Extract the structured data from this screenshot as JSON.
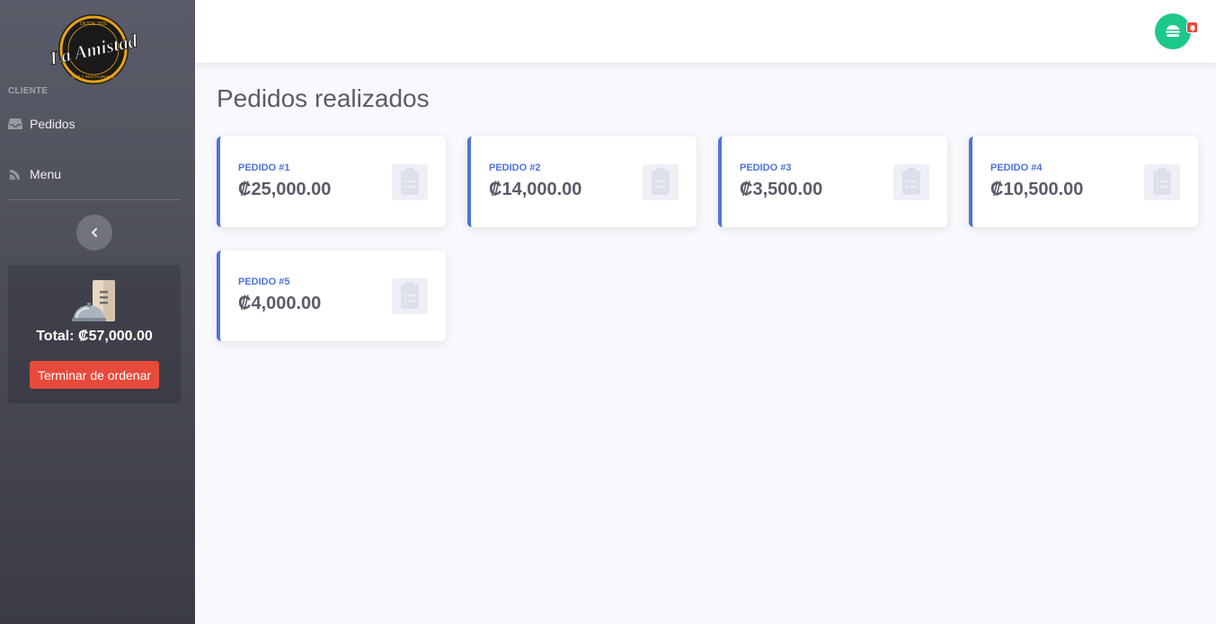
{
  "brand": {
    "name": "La Amistad",
    "tagline_top": "DESDE 2020",
    "tagline_bottom": "BAR Y RESTAURANTE",
    "logo_icon": "la-amistad-logo"
  },
  "sidebar": {
    "section_label": "CLIENTE",
    "items": [
      {
        "label": "Pedidos",
        "icon": "inbox-icon"
      },
      {
        "label": "Menu",
        "icon": "utensils-icon"
      }
    ],
    "toggle_icon": "chevron-left-icon"
  },
  "cart": {
    "icon": "service-bell-receipt-icon",
    "total_label": "Total: ₡57,000.00",
    "button_label": "Terminar de ordenar"
  },
  "topbar": {
    "avatar_icon": "burger-icon",
    "badge_icon": "bell-icon"
  },
  "main": {
    "title": "Pedidos realizados",
    "orders": [
      {
        "label": "PEDIDO #1",
        "amount": "₡25,000.00"
      },
      {
        "label": "PEDIDO #2",
        "amount": "₡14,000.00"
      },
      {
        "label": "PEDIDO #3",
        "amount": "₡3,500.00"
      },
      {
        "label": "PEDIDO #4",
        "amount": "₡10,500.00"
      },
      {
        "label": "PEDIDO #5",
        "amount": "₡4,000.00"
      }
    ]
  },
  "colors": {
    "primary": "#4e73df",
    "success": "#1cc88a",
    "danger": "#e74a3b",
    "text": "#5a5c69"
  }
}
